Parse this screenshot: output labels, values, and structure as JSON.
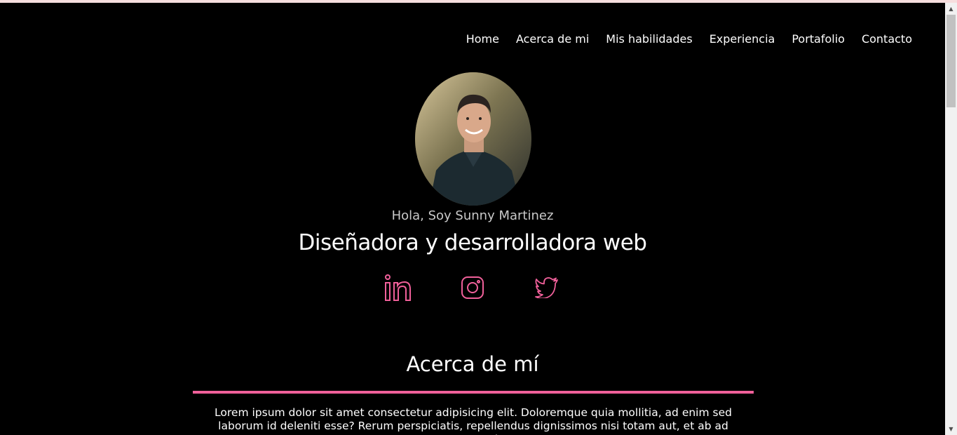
{
  "nav": {
    "items": [
      {
        "label": "Home"
      },
      {
        "label": "Acerca de mi"
      },
      {
        "label": "Mis habilidades"
      },
      {
        "label": "Experiencia"
      },
      {
        "label": "Portafolio"
      },
      {
        "label": "Contacto"
      }
    ]
  },
  "hero": {
    "greeting": "Hola, Soy Sunny Martinez",
    "role": "Diseñadora y desarrolladora web",
    "socials": [
      {
        "icon": "linkedin-icon"
      },
      {
        "icon": "instagram-icon"
      },
      {
        "icon": "twitter-icon"
      }
    ]
  },
  "about": {
    "title": "Acerca de mí",
    "text": "Lorem ipsum dolor sit amet consectetur adipisicing elit. Doloremque quia mollitia, ad enim sed laborum id deleniti esse? Rerum perspiciatis, repellendus dignissimos nisi totam aut, et ab ad assumenda"
  },
  "colors": {
    "accent": "#f0609a",
    "background": "#000000",
    "text": "#ffffff",
    "muted": "#c9c9c9"
  }
}
